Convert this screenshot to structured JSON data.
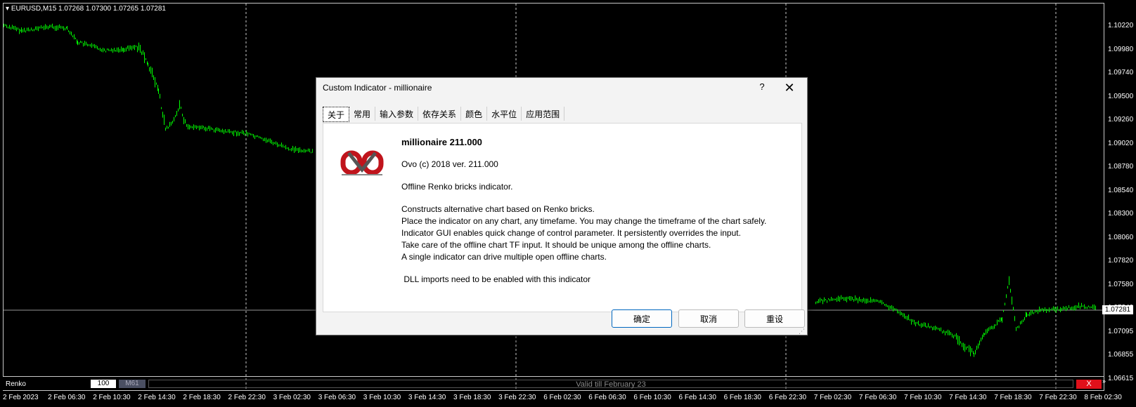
{
  "chart": {
    "symbol_line": "EURUSD,M15  1.07268 1.07300 1.07265 1.07281",
    "current_price": "1.07281",
    "price_ticks": [
      "1.10220",
      "1.09980",
      "1.09740",
      "1.09500",
      "1.09260",
      "1.09020",
      "1.08780",
      "1.08540",
      "1.08300",
      "1.08060",
      "1.07820",
      "1.07580",
      "1.07340",
      "1.07095",
      "1.06855",
      "1.06615"
    ],
    "time_ticks": [
      "2 Feb 2023",
      "2 Feb 06:30",
      "2 Feb 10:30",
      "2 Feb 14:30",
      "2 Feb 18:30",
      "2 Feb 22:30",
      "3 Feb 02:30",
      "3 Feb 06:30",
      "3 Feb 10:30",
      "3 Feb 14:30",
      "3 Feb 18:30",
      "3 Feb 22:30",
      "6 Feb 02:30",
      "6 Feb 06:30",
      "6 Feb 10:30",
      "6 Feb 14:30",
      "6 Feb 18:30",
      "6 Feb 22:30",
      "7 Feb 02:30",
      "7 Feb 06:30",
      "7 Feb 10:30",
      "7 Feb 14:30",
      "7 Feb 18:30",
      "7 Feb 22:30",
      "8 Feb 02:30"
    ],
    "colors": {
      "candles": "#00ff00",
      "background": "#000000",
      "grid": "#c8c8c8"
    }
  },
  "renko": {
    "label": "Renko",
    "brick_value": "100",
    "timeframe": "M61",
    "validity": "Valid till February 23",
    "close_label": "X",
    "scroll_icon": "double-chevron-icon"
  },
  "dialog": {
    "title": "Custom Indicator - millionaire",
    "help": "?",
    "close": "✕",
    "tabs": [
      "关于",
      "常用",
      "输入参数",
      "依存关系",
      "颜色",
      "水平位",
      "应用范围"
    ],
    "active_tab": 0,
    "logo_icon": "ovo-logo-icon",
    "info": {
      "name": "millionaire 211.000",
      "copyright": "Ovo (c) 2018 ver. 211.000",
      "summary": "Offline Renko bricks indicator.",
      "lines": [
        "Constructs alternative chart based on Renko bricks.",
        "Place the indicator on any chart, any timefame. You may change the timeframe of the chart safely.",
        "Indicator GUI enables quick change of control parameter. It persistently overrides the input.",
        "Take care of the offline chart TF input. It should be unique among the offline charts.",
        "A single indicator can drive multiple open offline charts."
      ],
      "note": " DLL imports need to be enabled with this indicator"
    },
    "buttons": {
      "ok": "确定",
      "cancel": "取消",
      "reset": "重设"
    }
  }
}
